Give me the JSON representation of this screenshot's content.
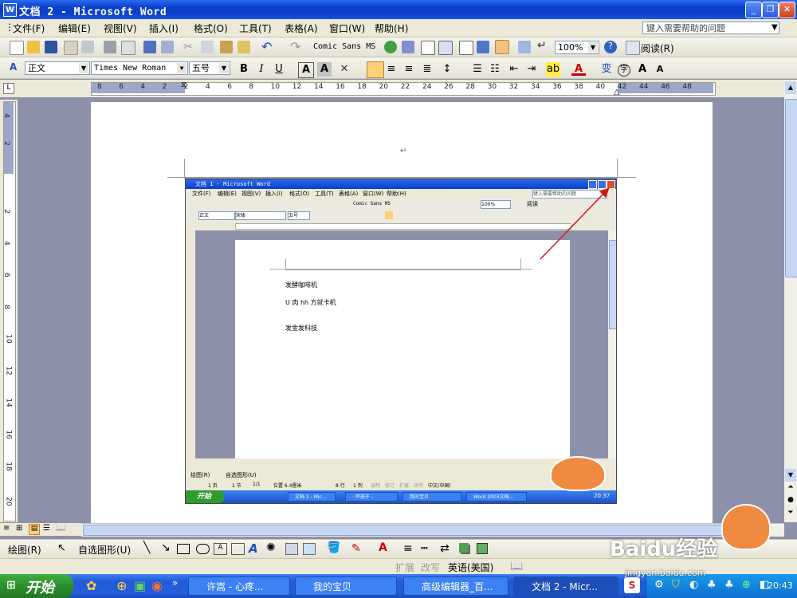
{
  "window": {
    "title": "文档 2 - Microsoft Word",
    "controls": [
      "minimize",
      "restore",
      "close"
    ]
  },
  "menubar": {
    "items": [
      "文件(F)",
      "编辑(E)",
      "视图(V)",
      "插入(I)",
      "格式(O)",
      "工具(T)",
      "表格(A)",
      "窗口(W)",
      "帮助(H)"
    ],
    "help_placeholder": "键入需要帮助的问题"
  },
  "standard_toolbar": {
    "font_preview": "Comic Sans MS",
    "zoom": "100%",
    "read_label": "阅读(R)"
  },
  "formatting_toolbar": {
    "style": "正文",
    "font": "Times New Roman",
    "size": "五号",
    "bold": "B",
    "italic": "I",
    "underline": "U"
  },
  "ruler": {
    "h_marks": [
      "8",
      "6",
      "4",
      "2",
      "2",
      "4",
      "6",
      "8",
      "10",
      "12",
      "14",
      "16",
      "18",
      "20",
      "22",
      "24",
      "26",
      "28",
      "30",
      "32",
      "34",
      "36",
      "38",
      "40",
      "42",
      "44",
      "46",
      "48"
    ],
    "v_marks": [
      "4",
      "2",
      "2",
      "4",
      "6",
      "8",
      "10",
      "12",
      "14",
      "16",
      "18",
      "20"
    ]
  },
  "document": {
    "paragraph_mark": "↵"
  },
  "nested_window": {
    "title": "文档 1 - Microsoft Word",
    "menu_items": [
      "文件(F)",
      "编辑(E)",
      "视图(V)",
      "插入(I)",
      "格式(O)",
      "工具(T)",
      "表格(A)",
      "窗口(W)",
      "帮助(H)"
    ],
    "help_placeholder": "键入需要帮助的问题",
    "font_preview": "Comic Sans MS",
    "zoom": "100%",
    "read_label": "阅读",
    "style": "正文",
    "font": "宋体",
    "size": "五号",
    "lines": [
      "发酵咖啡机",
      "U 肉 hh 方就卡机",
      "发金发科技"
    ],
    "status": [
      "1 页",
      "1 节",
      "1/1",
      "位置 6.4厘米",
      "8 行",
      "1 列",
      "录制",
      "修订",
      "扩展",
      "改写",
      "中文(中国)"
    ],
    "taskbar": {
      "start": "开始",
      "tasks": [
        "文档 1 - Mic...",
        "· 坏孩子 -",
        "我的宝贝",
        "Word 2003文档..."
      ],
      "clock": "20:37"
    },
    "draw_label": "绘图(R)",
    "autoshape_label": "自选图形(U)"
  },
  "drawbar": {
    "draw_label": "绘图(R)",
    "autoshape_label": "自选图形(U)"
  },
  "statusbar": {
    "items": [
      "扩展",
      "改写",
      "英语(美国)"
    ]
  },
  "taskbar": {
    "start": "开始",
    "tasks": [
      "许嵩 - 心疼...",
      "我的宝贝",
      "高级编辑器_百...",
      "文档 2 - Micr..."
    ],
    "clock": "20:43"
  },
  "watermark": {
    "logo": "Baidu经验",
    "url": "jingyan.baidu.com"
  },
  "colors": {
    "titlebar": "#0a3fc9",
    "arrow": "#d01818",
    "taskbar": "#245edc",
    "start": "#2c8f2c"
  }
}
